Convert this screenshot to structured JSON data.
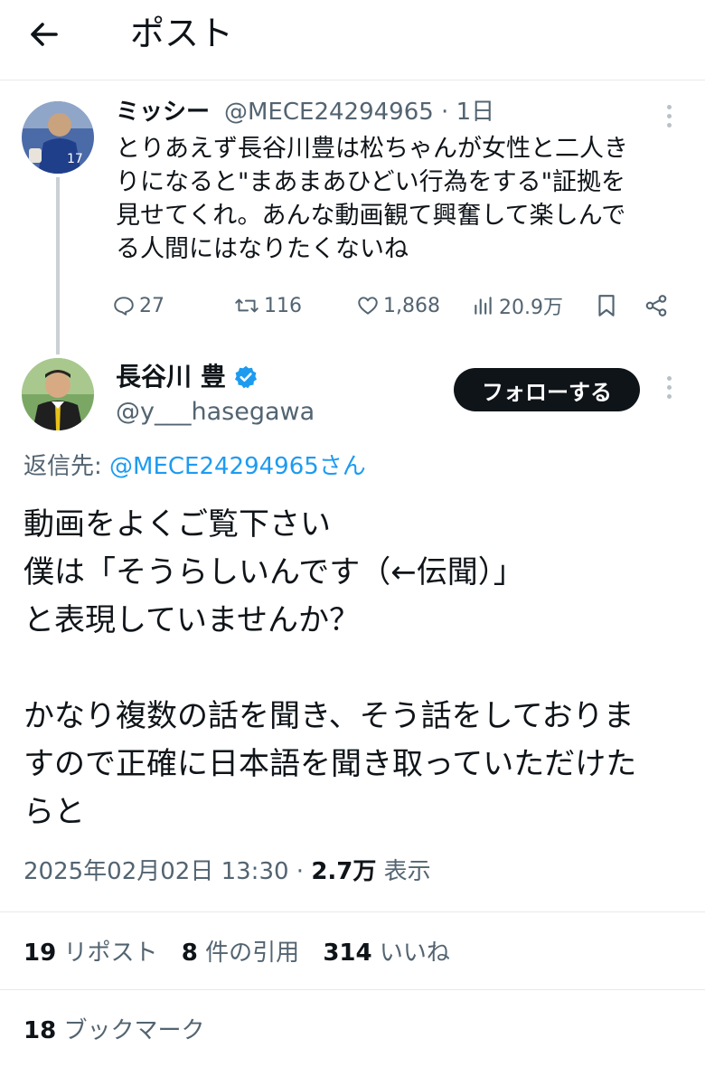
{
  "header": {
    "title": "ポスト",
    "back_icon": "arrow-left-icon"
  },
  "parent_tweet": {
    "display_name": "ミッシー",
    "handle_time": "@MECE24294965 · 1日",
    "lines": [
      "とりあえず長谷川豊は松ちゃんが女性と二人き",
      "りになると\"まあまあひどい行為をする\"証拠を",
      "見せてくれ。あんな動画観て興奮して楽しんで",
      "る人間にはなりたくないね"
    ],
    "actions": {
      "replies": "27",
      "reposts": "116",
      "likes": "1,868",
      "views": "20.9万"
    }
  },
  "main_tweet": {
    "display_name": "長谷川 豊",
    "handle": "@y___hasegawa",
    "follow_label": "フォローする",
    "reply_prefix": "返信先: ",
    "reply_mention": "@MECE24294965さん",
    "lines": [
      "動画をよくご覧下さい",
      "僕は「そうらしいんです（←伝聞）」",
      "と表現していませんか？",
      "",
      "かなり複数の話を聞き、そう話をしておりま",
      "すので正確に日本語を聞き取っていただけた",
      "らと"
    ],
    "timestamp": "2025年02月02日 13:30 · ",
    "views_count": "2.7万",
    "views_label": " 表示",
    "stats": {
      "reposts_count": "19",
      "reposts_label": " リポスト",
      "quotes_count": "8",
      "quotes_label": " 件の引用",
      "likes_count": "314",
      "likes_label": " いいね",
      "bookmarks_count": "18",
      "bookmarks_label": " ブックマーク"
    }
  },
  "colors": {
    "accent": "#1d9bf0",
    "text": "#0f1419",
    "secondary": "#536471"
  }
}
